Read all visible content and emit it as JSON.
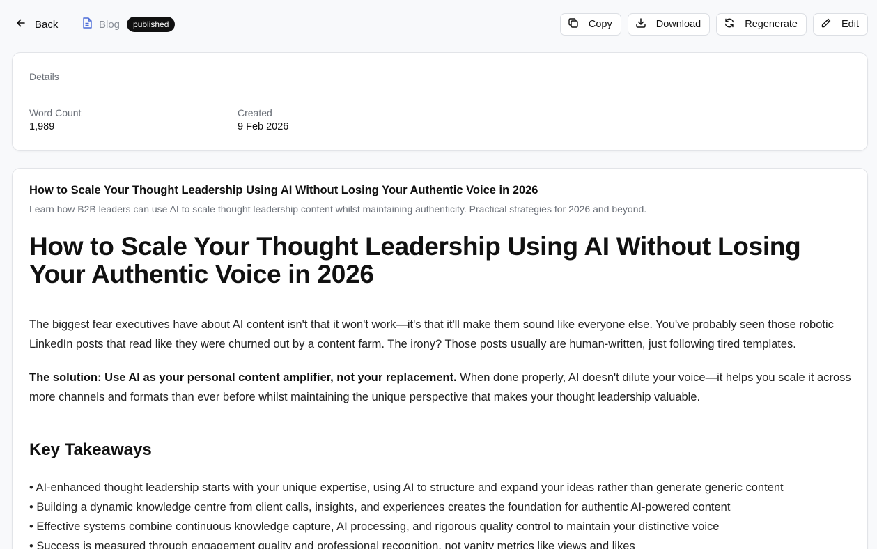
{
  "topbar": {
    "back_label": "Back",
    "crumb_label": "Blog",
    "status_badge": "published",
    "actions": {
      "copy": "Copy",
      "download": "Download",
      "regenerate": "Regenerate",
      "edit": "Edit"
    }
  },
  "details": {
    "heading": "Details",
    "word_count_label": "Word Count",
    "word_count_value": "1,989",
    "created_label": "Created",
    "created_value": "9 Feb 2026"
  },
  "content": {
    "meta_title": "How to Scale Your Thought Leadership Using AI Without Losing Your Authentic Voice in 2026",
    "meta_description": "Learn how B2B leaders can use AI to scale thought leadership content whilst maintaining authenticity. Practical strategies for 2026 and beyond.",
    "heading": "How to Scale Your Thought Leadership Using AI Without Losing Your Authentic Voice in 2026",
    "paragraph_1": "The biggest fear executives have about AI content isn't that it won't work—it's that it'll make them sound like everyone else. You've probably seen those robotic LinkedIn posts that read like they were churned out by a content farm. The irony? Those posts usually are human-written, just following tired templates.",
    "paragraph_2_bold": "The solution: Use AI as your personal content amplifier, not your replacement.",
    "paragraph_2_rest": " When done properly, AI doesn't dilute your voice—it helps you scale it across more channels and formats than ever before whilst maintaining the unique perspective that makes your thought leadership valuable.",
    "takeaways_heading": "Key Takeaways",
    "takeaways": [
      "• AI-enhanced thought leadership starts with your unique expertise, using AI to structure and expand your ideas rather than generate generic content",
      "• Building a dynamic knowledge centre from client calls, insights, and experiences creates the foundation for authentic AI-powered content",
      "• Effective systems combine continuous knowledge capture, AI processing, and rigorous quality control to maintain your distinctive voice",
      "• Success is measured through engagement quality and professional recognition, not vanity metrics like views and likes"
    ]
  }
}
